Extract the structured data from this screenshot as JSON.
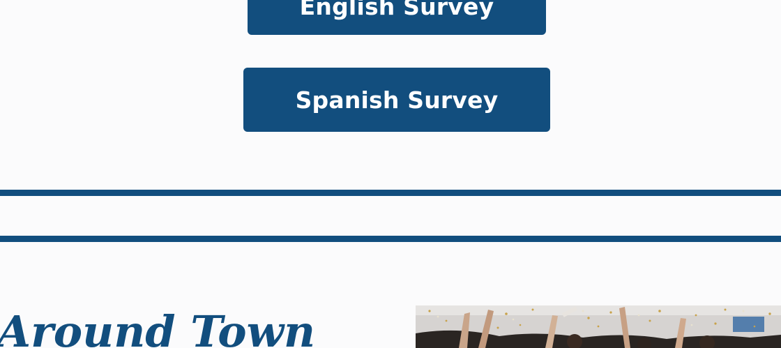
{
  "surveys": {
    "english_label": "English Survey",
    "spanish_label": "Spanish Survey"
  },
  "around_town": {
    "title": "Around Town",
    "photo_subject": "graduation-celebration-confetti-photo"
  },
  "colors": {
    "brand_blue": "#124e7e",
    "background": "#fbfbfc",
    "button_text": "#ffffff"
  }
}
